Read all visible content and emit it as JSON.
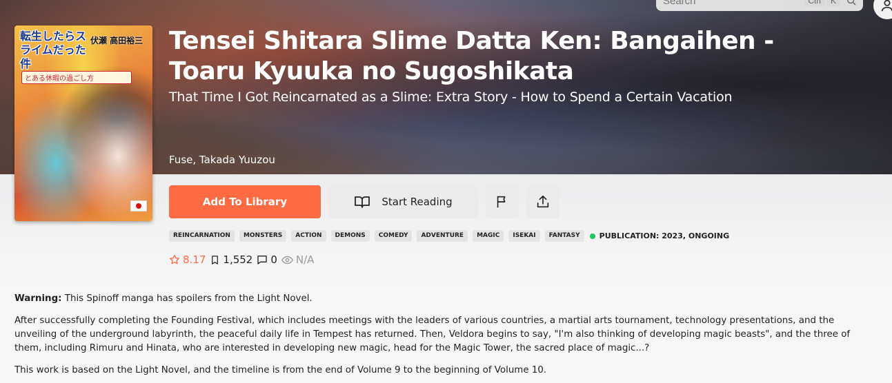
{
  "header": {
    "search_placeholder": "Search",
    "shortcut_key1": "Ctrl",
    "shortcut_key2": "K"
  },
  "manga": {
    "title": "Tensei Shitara Slime Datta Ken: Bangaihen - Toaru Kyuuka no Sugoshikata",
    "alt_title": "That Time I Got Reincarnated as a Slime: Extra Story - How to Spend a Certain Vacation",
    "authors": "Fuse, Takada Yuuzou",
    "cover": {
      "title_text": "転生したらスライムだった件",
      "authors_text": "伏瀬 高田裕三",
      "subtitle_text": "とある休暇の過ごし方",
      "flag": "japan-flag"
    }
  },
  "actions": {
    "add_to_library": "Add To Library",
    "start_reading": "Start Reading"
  },
  "tags": [
    "REINCARNATION",
    "MONSTERS",
    "ACTION",
    "DEMONS",
    "COMEDY",
    "ADVENTURE",
    "MAGIC",
    "ISEKAI",
    "FANTASY"
  ],
  "publication": "PUBLICATION: 2023, ONGOING",
  "stats": {
    "rating": "8.17",
    "follows": "1,552",
    "comments": "0",
    "views": "N/A"
  },
  "description": {
    "warning_label": "Warning:",
    "warning_text": " This Spinoff manga has spoilers from the Light Novel.",
    "paragraph1": "After successfully completing the Founding Festival, which includes meetings with the leaders of various countries, a martial arts tournament, technology presentations, and the unveiling of the underground labyrinth, the peaceful daily life in Tempest has returned. Then, Veldora begins to say, \"I'm also thinking of developing magic beasts\", and the three of them, including Rimuru and Hinata, who are interested in developing new magic, head for the Magic Tower, the sacred place of magic...?",
    "paragraph2": "This work is based on the Light Novel, and the timeline is from the end of Volume 9 to the beginning of Volume 10."
  },
  "colors": {
    "accent": "#fe6a42",
    "status_ongoing": "#22c55e"
  }
}
